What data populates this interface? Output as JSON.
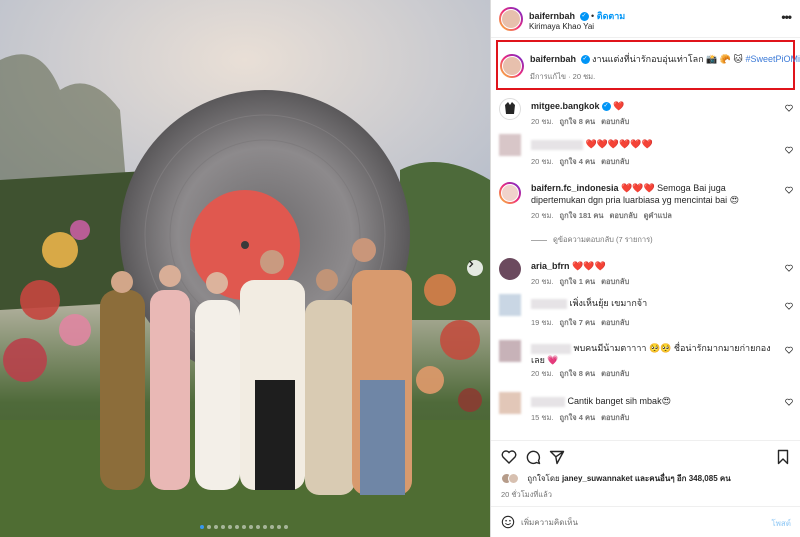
{
  "post": {
    "username": "baifernbah",
    "follow_label": "ติดตาม",
    "location": "Kirimaya Khao Yai",
    "more_icon": "more-horizontal-icon"
  },
  "caption": {
    "username": "baifernbah",
    "text": "งานแต่งที่น่ารักอบอุ่นเท่าโลก 📸 🥐 🐱",
    "hashtag": "#SweetPiOMild",
    "meta": "มีการแก้ไข · 20 ชม."
  },
  "comments": [
    {
      "username": "mitgee.bangkok",
      "text": "❤️",
      "time": "20 ชม.",
      "likes": "ถูกใจ 8 คน",
      "reply": "ตอบกลับ"
    },
    {
      "username": "",
      "text": "❤️❤️❤️❤️❤️❤️",
      "time": "20 ชม.",
      "likes": "ถูกใจ 4 คน",
      "reply": "ตอบกลับ"
    },
    {
      "username": "baifern.fc_indonesia",
      "text": "❤️❤️❤️ Semoga Bai juga dipertemukan dgn pria luarbiasa yg mencintai bai 😍",
      "time": "20 ชม.",
      "likes": "ถูกใจ 181 คน",
      "reply": "ตอบกลับ",
      "translate": "ดูคำแปล"
    },
    {
      "username": "aria_bfrn",
      "text": "❤️❤️❤️",
      "time": "20 ชม.",
      "likes": "ถูกใจ 1 คน",
      "reply": "ตอบกลับ"
    },
    {
      "username": "",
      "text": "เพิ่งเห็นยุ้ย เขมากจ้า",
      "time": "19 ชม.",
      "likes": "ถูกใจ 7 คน",
      "reply": "ตอบกลับ"
    },
    {
      "username": "",
      "text": "พบคนมีน้ามตาาาา 🥺🥺 ชื่อน่ารักมากมายก่ายกองเลย 💗",
      "time": "20 ชม.",
      "likes": "ถูกใจ 8 คน",
      "reply": "ตอบกลับ"
    },
    {
      "username": "",
      "text": "Cantik banget sih mbak😍",
      "time": "15 ชม.",
      "likes": "ถูกใจ 4 คน",
      "reply": "ตอบกลับ"
    }
  ],
  "view_replies": "ดูข้อความตอบกลับ (7 รายการ)",
  "likes_line": {
    "prefix": "ถูกใจโดย",
    "user": "janey_suwannaket",
    "middle": "และคนอื่นๆ",
    "count": "อีก 348,085 คน"
  },
  "post_time": "20 ชั่วโมงที่แล้ว",
  "add_comment": {
    "placeholder": "เพิ่มความคิดเห็น",
    "post_label": "โพสต์"
  },
  "colors": {
    "accent": "#0095f6",
    "highlight_border": "#e0141b",
    "heart": "#ed4956"
  }
}
